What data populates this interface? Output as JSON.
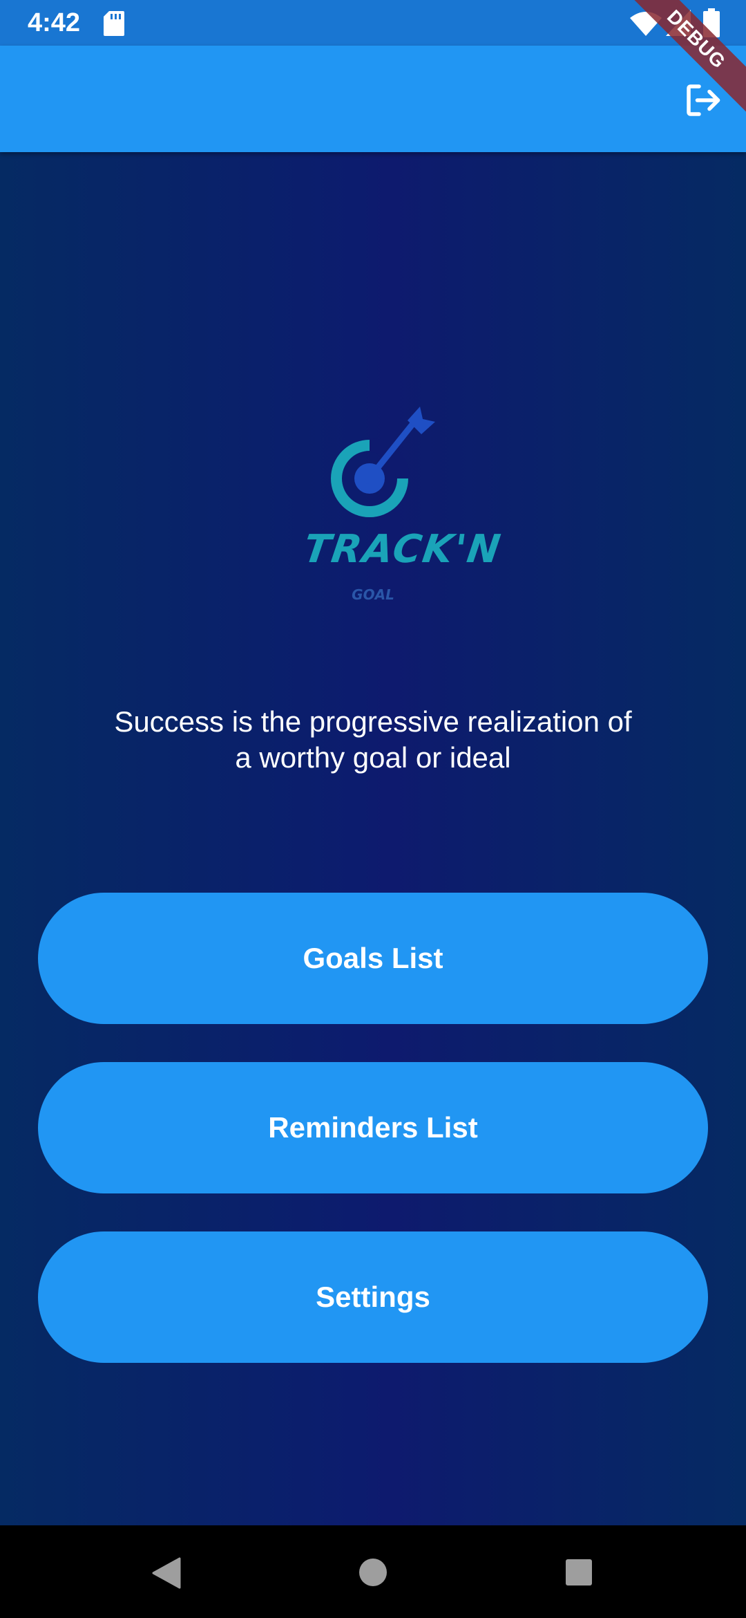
{
  "status_bar": {
    "time": "4:42",
    "icons": [
      "sd-card-icon",
      "wifi-icon",
      "signal-icon",
      "battery-icon"
    ]
  },
  "debug_banner": {
    "label": "DEBUG"
  },
  "app_bar": {
    "actions": [
      {
        "icon": "logout-icon"
      }
    ],
    "color": "#2196F3"
  },
  "logo": {
    "title": "TRACK'N",
    "subtitle": "GOAL",
    "icon": "target-arrow-icon"
  },
  "quote": {
    "line1": "Success is the progressive realization of",
    "line2": "a worthy goal or ideal"
  },
  "buttons": {
    "goals_list": "Goals List",
    "reminders_list": "Reminders List",
    "settings": "Settings"
  },
  "nav_bar": {
    "icons": [
      "back-icon",
      "home-icon",
      "recent-apps-icon"
    ]
  },
  "colors": {
    "status_bar": "#1976D2",
    "accent": "#2196F3",
    "background_dark": "#052a63",
    "background_center": "#0e1a6e",
    "logo_teal": "#1aa3b8"
  }
}
